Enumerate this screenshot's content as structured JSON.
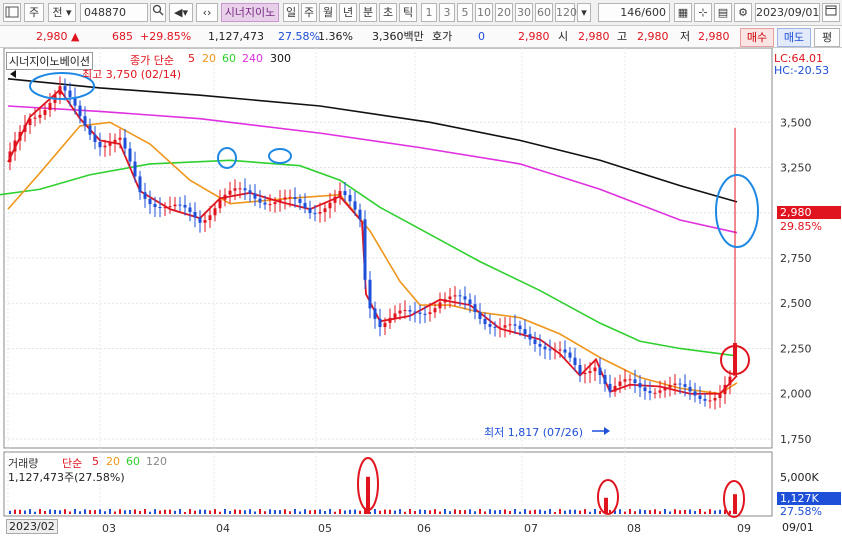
{
  "toolbar": {
    "period_label": "주",
    "prev_label": "전",
    "code": "048870",
    "company": "시너지이노",
    "period_tabs": [
      "일",
      "주",
      "월",
      "년",
      "분",
      "초",
      "틱"
    ],
    "active_tab": "일",
    "numbers": [
      "1",
      "3",
      "5",
      "10",
      "20",
      "30",
      "60",
      "120"
    ],
    "count": "146",
    "count_total": "/600",
    "date": "2023/09/01"
  },
  "quote": {
    "price": "2,980",
    "change": "685",
    "change_pct": "+29.85%",
    "volume": "1,127,473",
    "turnover_pct": "27.58%",
    "ratio": "1.36%",
    "amount": "3,360백만",
    "hoga_label": "호가",
    "hoga_value": "0",
    "bid": "2,980",
    "open_label": "시",
    "open": "2,980",
    "high_label": "고",
    "high": "2,980",
    "low_label": "저",
    "low": "2,980",
    "buy_label": "매수",
    "sell_label": "매도",
    "eval_label": "평"
  },
  "chart": {
    "company_label": "시너지이노베이션",
    "ma_label": "종가 단순",
    "ma_periods": [
      "5",
      "20",
      "60",
      "240",
      "300"
    ],
    "max_label": "최고 3,750 (02/14)",
    "min_label": "최저 1,817 (07/26)",
    "lc": "LC:64.01",
    "hc": "HC:-20.53",
    "current_price": "2,980",
    "current_pct": "29.85%",
    "vol_label": "거래량",
    "vol_ma_label": "단순",
    "vol_ma_periods": [
      "5",
      "20",
      "60",
      "120"
    ],
    "vol_value": "1,127,473주(27.58%)",
    "vol_current": "1,127K",
    "vol_current_pct": "27.58%",
    "vol_axis_top": "5,000K",
    "date_tag": "2023/02",
    "date_end": "09/01",
    "colors": {
      "up": "#e0141e",
      "down": "#1d4fd8",
      "ma5": "#e0141e",
      "ma20": "#f0961c",
      "ma60": "#2fd02f",
      "ma240": "#e030e0",
      "ma300": "#111111",
      "highlight_blue": "#1e88e5",
      "highlight_red": "#e0141e"
    }
  },
  "chart_data": {
    "type": "candlestick",
    "price_axis": {
      "ticks": [
        3500,
        3250,
        3000,
        2750,
        2500,
        2250,
        2000,
        1750
      ],
      "range": [
        1700,
        3800
      ]
    },
    "x_ticks": [
      "2023/02",
      "03",
      "04",
      "05",
      "06",
      "07",
      "08",
      "09"
    ],
    "ma60": [
      [
        0,
        3100
      ],
      [
        40,
        3130
      ],
      [
        90,
        3210
      ],
      [
        150,
        3270
      ],
      [
        230,
        3290
      ],
      [
        300,
        3260
      ],
      [
        340,
        3180
      ],
      [
        380,
        3030
      ],
      [
        430,
        2880
      ],
      [
        480,
        2730
      ],
      [
        540,
        2570
      ],
      [
        600,
        2390
      ],
      [
        640,
        2290
      ],
      [
        680,
        2250
      ],
      [
        735,
        2210
      ]
    ],
    "ma240": [
      [
        8,
        3590
      ],
      [
        100,
        3560
      ],
      [
        200,
        3520
      ],
      [
        320,
        3440
      ],
      [
        420,
        3360
      ],
      [
        520,
        3270
      ],
      [
        600,
        3130
      ],
      [
        680,
        2960
      ],
      [
        737,
        2890
      ]
    ],
    "ma300": [
      [
        8,
        3740
      ],
      [
        100,
        3690
      ],
      [
        200,
        3650
      ],
      [
        320,
        3590
      ],
      [
        430,
        3500
      ],
      [
        520,
        3400
      ],
      [
        600,
        3290
      ],
      [
        680,
        3150
      ],
      [
        737,
        3060
      ]
    ],
    "ma20": [
      [
        8,
        3020
      ],
      [
        40,
        3220
      ],
      [
        80,
        3480
      ],
      [
        110,
        3500
      ],
      [
        150,
        3380
      ],
      [
        190,
        3180
      ],
      [
        230,
        3050
      ],
      [
        290,
        3080
      ],
      [
        340,
        3100
      ],
      [
        370,
        2900
      ],
      [
        400,
        2620
      ],
      [
        420,
        2490
      ],
      [
        450,
        2490
      ],
      [
        480,
        2450
      ],
      [
        520,
        2420
      ],
      [
        560,
        2330
      ],
      [
        600,
        2200
      ],
      [
        640,
        2090
      ],
      [
        680,
        2030
      ],
      [
        720,
        2000
      ],
      [
        737,
        2060
      ]
    ],
    "ma5": [
      [
        8,
        3280
      ],
      [
        30,
        3530
      ],
      [
        60,
        3680
      ],
      [
        80,
        3520
      ],
      [
        100,
        3400
      ],
      [
        120,
        3380
      ],
      [
        140,
        3120
      ],
      [
        170,
        3020
      ],
      [
        200,
        2970
      ],
      [
        220,
        3080
      ],
      [
        250,
        3110
      ],
      [
        280,
        3060
      ],
      [
        310,
        3020
      ],
      [
        340,
        3090
      ],
      [
        362,
        2950
      ],
      [
        366,
        2550
      ],
      [
        380,
        2400
      ],
      [
        410,
        2430
      ],
      [
        440,
        2520
      ],
      [
        470,
        2490
      ],
      [
        500,
        2360
      ],
      [
        540,
        2300
      ],
      [
        560,
        2220
      ],
      [
        580,
        2100
      ],
      [
        596,
        2190
      ],
      [
        610,
        2010
      ],
      [
        630,
        2050
      ],
      [
        660,
        2040
      ],
      [
        690,
        2000
      ],
      [
        720,
        2000
      ],
      [
        737,
        2100
      ]
    ],
    "volume_spikes_pct": [
      [
        368,
        0.62
      ],
      [
        606,
        0.27
      ],
      [
        735,
        0.33
      ]
    ]
  }
}
